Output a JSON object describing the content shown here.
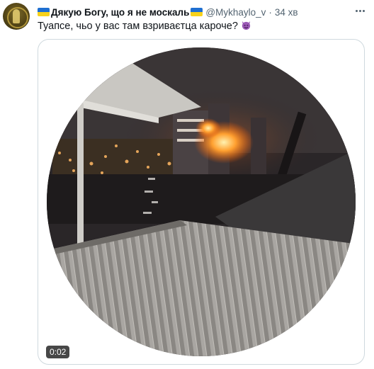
{
  "tweet": {
    "display_name": "Дякую Богу, що я не москаль",
    "handle": "@Mykhaylo_v",
    "separator": "·",
    "time": "34 хв",
    "text": "Туапсе, чьо у вас там взриваєтца кароче?",
    "avatar_icon": "avatar-image",
    "flag_icon": "ukraine-flag-icon",
    "emoji": "smiling-devil-emoji"
  },
  "video": {
    "duration": "0:02"
  },
  "colors": {
    "text": "#0f1419",
    "secondary": "#536471",
    "border": "#cfd9de",
    "flag_blue": "#1f6fd1",
    "flag_yellow": "#f7d21b"
  }
}
